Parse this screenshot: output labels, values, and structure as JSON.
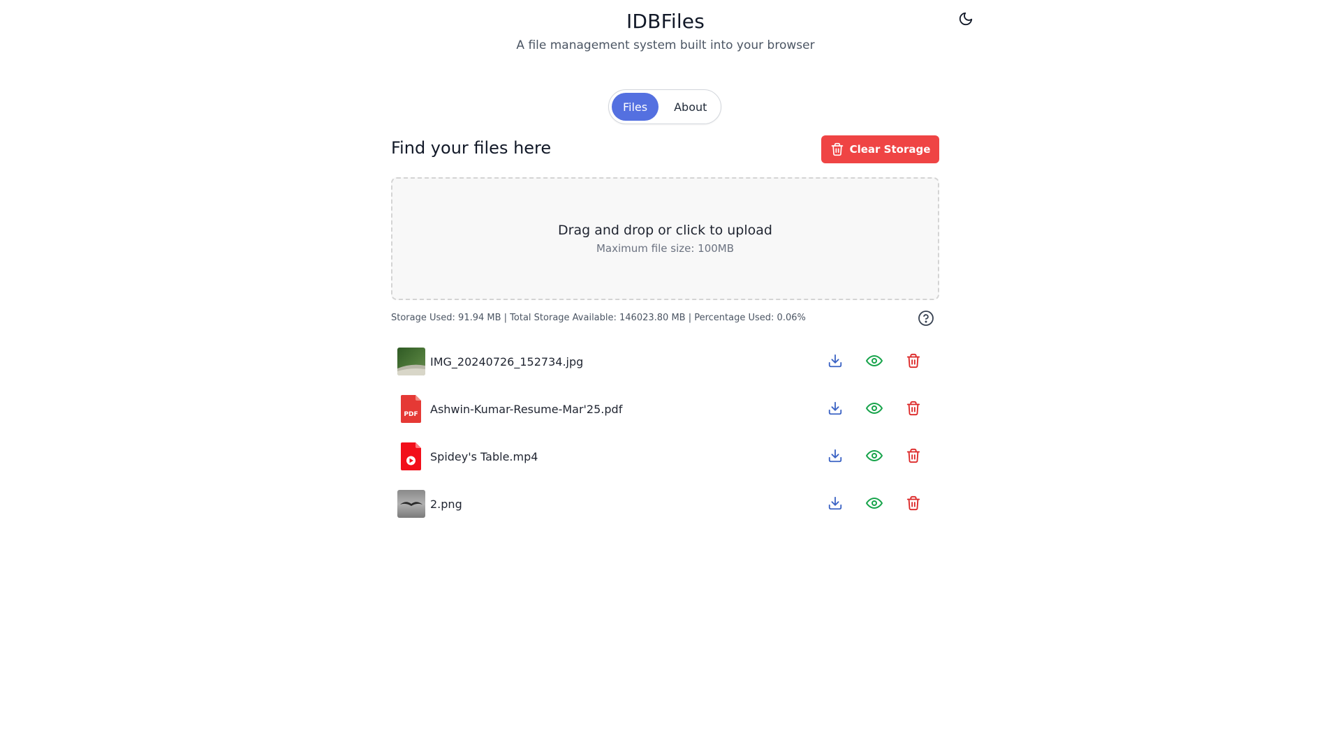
{
  "header": {
    "title": "IDBFiles",
    "subtitle": "A file management system built into your browser",
    "theme_icon": "moon-icon"
  },
  "tabs": [
    {
      "label": "Files",
      "active": true
    },
    {
      "label": "About",
      "active": false
    }
  ],
  "main": {
    "section_title": "Find your files here",
    "clear_button_label": "Clear Storage",
    "dropzone_title": "Drag and drop or click to upload",
    "dropzone_subtitle": "Maximum file size: 100MB",
    "storage_info": "Storage Used: 91.94 MB | Total Storage Available: 146023.80 MB | Percentage Used: 0.06%"
  },
  "files": [
    {
      "name": "IMG_20240726_152734.jpg",
      "type": "image-thumb"
    },
    {
      "name": "Ashwin-Kumar-Resume-Mar'25.pdf",
      "type": "pdf-icon"
    },
    {
      "name": "Spidey's Table.mp4",
      "type": "video-icon"
    },
    {
      "name": "2.png",
      "type": "image-thumb"
    }
  ],
  "colors": {
    "accent": "#5470e0",
    "danger": "#ef4444",
    "download": "#3b63c4",
    "view": "#16a34a",
    "delete": "#dc2626"
  },
  "icons": {
    "pdf_label": "PDF"
  }
}
